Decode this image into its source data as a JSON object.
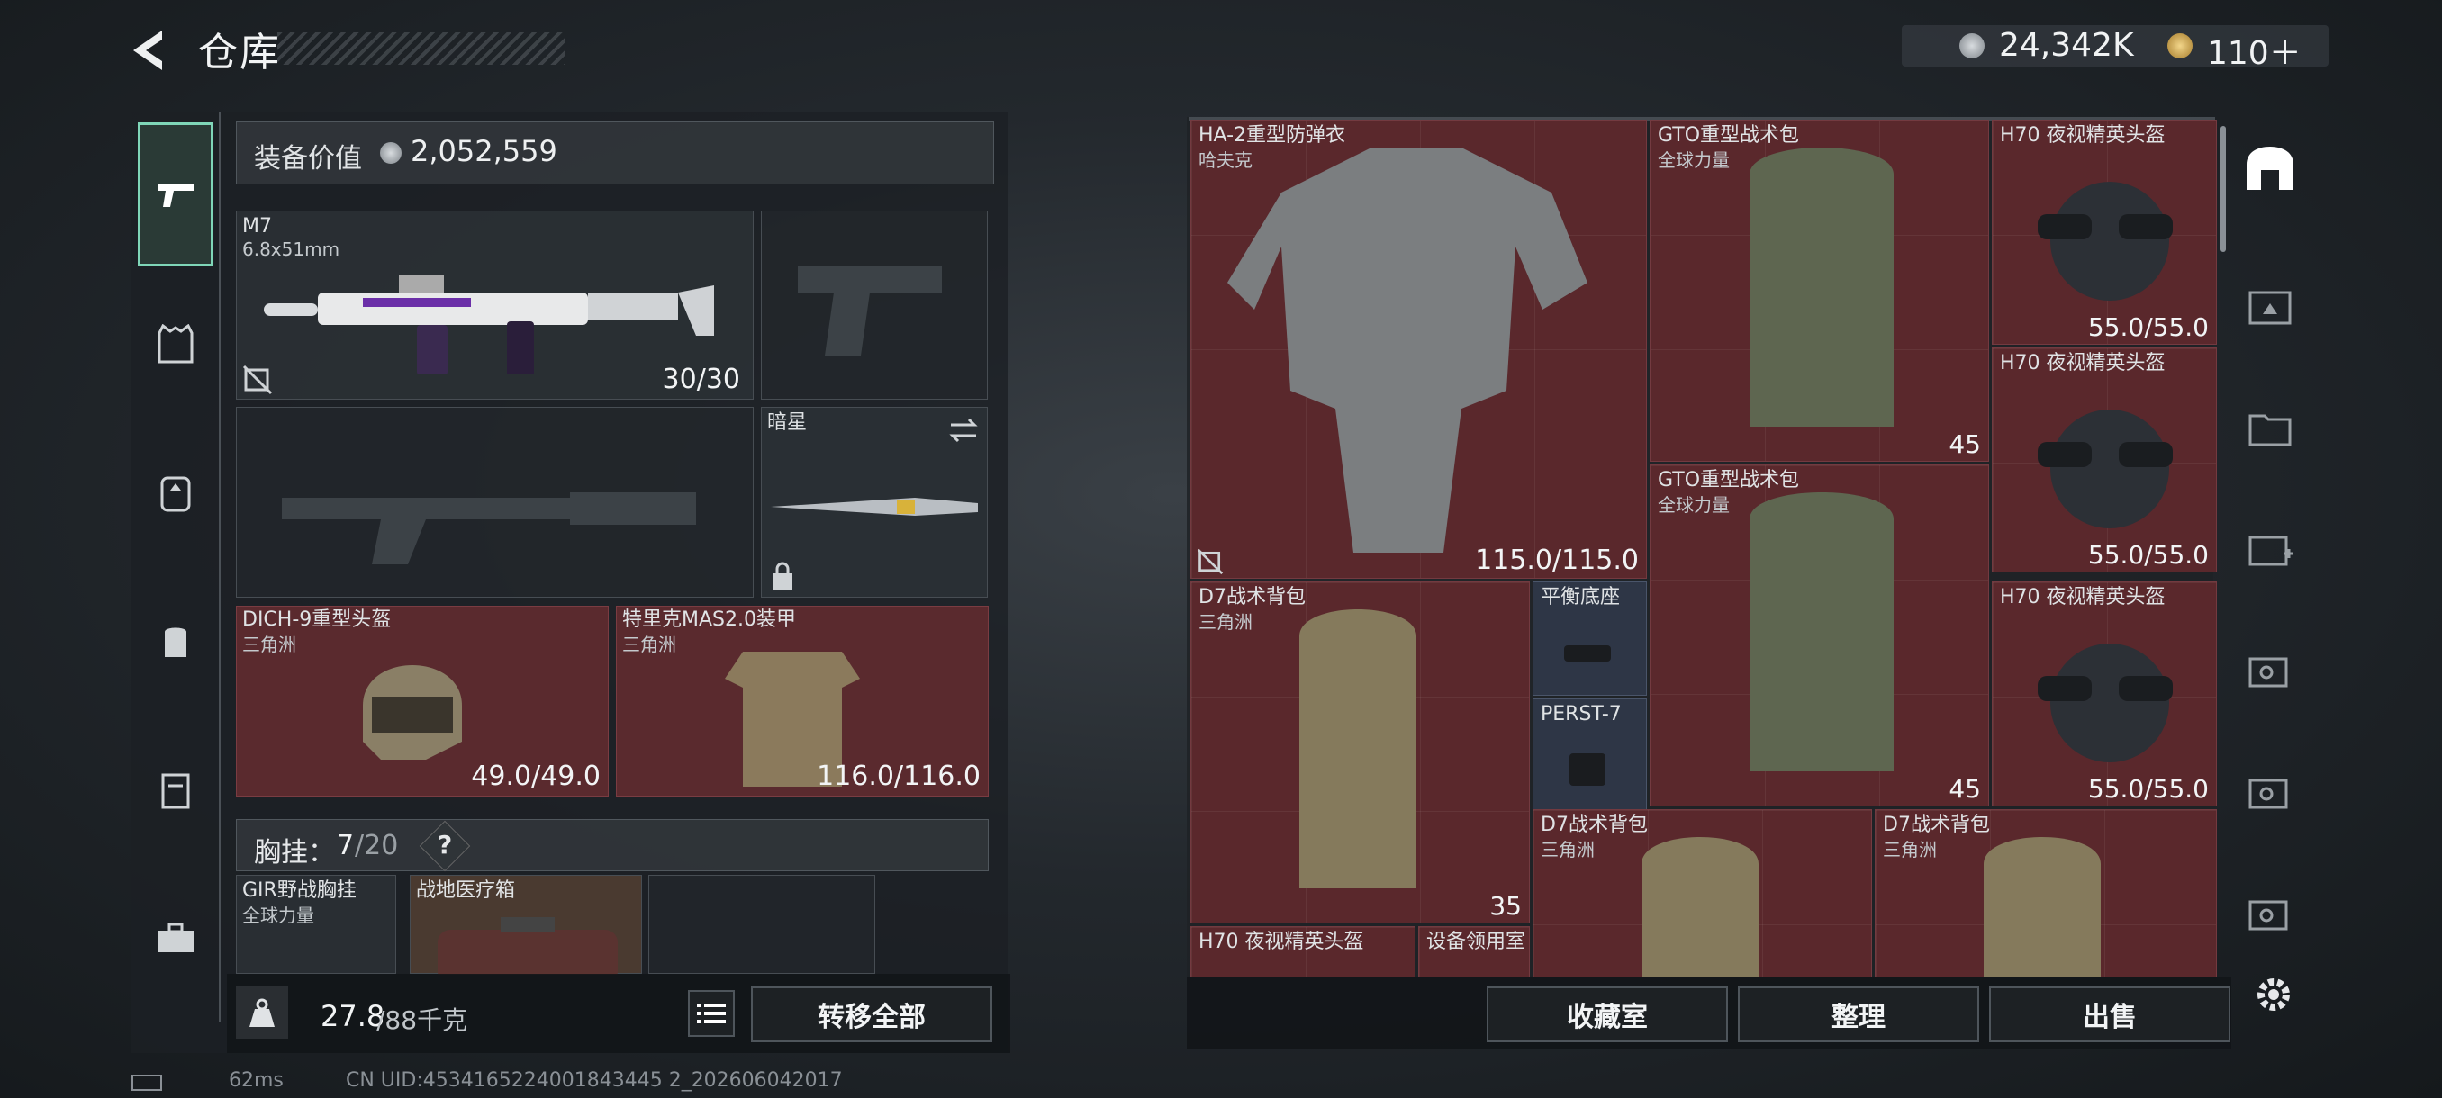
{
  "header": {
    "title": "仓库",
    "currency1": "24,342K",
    "currency2": "110＋"
  },
  "left": {
    "equip_value_label": "装备价值",
    "equip_value": "2,052,559",
    "primary": {
      "name": "M7",
      "caliber": "6.8x51mm",
      "ammo": "30/30"
    },
    "melee": {
      "name": "暗星"
    },
    "helmet": {
      "name": "DICH-9重型头盔",
      "maker": "三角洲",
      "dur": "49.0/49.0"
    },
    "armor": {
      "name": "特里克MAS2.0装甲",
      "maker": "三角洲",
      "dur": "116.0/116.0"
    },
    "rig": {
      "label": "胸挂：",
      "count": "7",
      "capacity": "/20",
      "help": "?"
    },
    "rig_items": [
      {
        "name": "GIR野战胸挂",
        "maker": "全球力量"
      },
      {
        "name": "战地医疗箱"
      }
    ],
    "weight": "27.8",
    "weight_max": "/88千克",
    "transfer_all": "转移全部"
  },
  "stash": {
    "items": [
      {
        "name": "HA-2重型防弹衣",
        "maker": "哈夫克",
        "value": "115.0/115.0"
      },
      {
        "name": "GTO重型战术包",
        "maker": "全球力量",
        "value": "45"
      },
      {
        "name": "H70 夜视精英头盔",
        "value": "55.0/55.0"
      },
      {
        "name": "H70 夜视精英头盔",
        "value": "55.0/55.0"
      },
      {
        "name": "GTO重型战术包",
        "maker": "全球力量",
        "value": "45"
      },
      {
        "name": "D7战术背包",
        "maker": "三角洲",
        "value": "35"
      },
      {
        "name": "平衡底座"
      },
      {
        "name": "PERST-7"
      },
      {
        "name": "H70 夜视精英头盔",
        "value": "55.0/55.0"
      },
      {
        "name": "D7战术背包",
        "maker": "三角洲"
      },
      {
        "name": "D7战术背包",
        "maker": "三角洲"
      },
      {
        "name": "H70 夜视精英头盔"
      },
      {
        "name": "设备领用室"
      }
    ],
    "btn_collection": "收藏室",
    "btn_sort": "整理",
    "btn_sell": "出售"
  },
  "status": {
    "ping": "62ms",
    "uid": "CN UID:4534165224001843445 2_202606042017"
  },
  "colors": {
    "accent": "#7fd6b8",
    "item_red": "#5a282c",
    "item_blue": "#2e3646"
  }
}
